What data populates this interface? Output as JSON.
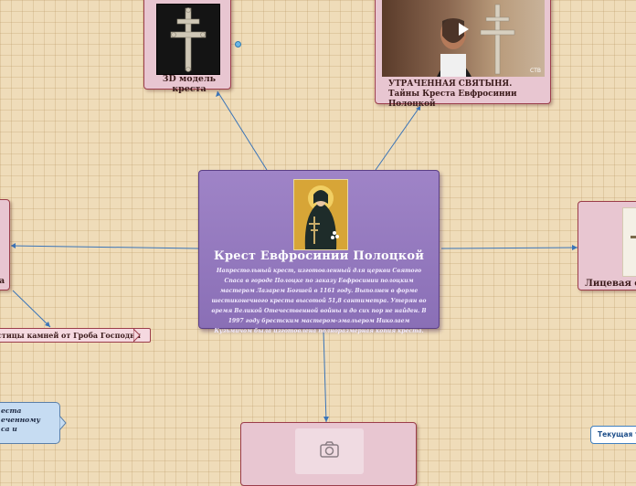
{
  "central": {
    "title": "Крест  Евфросинии Полоцкой",
    "description": "Напрестольный крест, изготовленный для церкви Святого Спаса в городе Полоцке по заказу Евфросинии полоцким мастером Лазарем Богшей в 1161 году. Выполнен в форме шестиконечного креста высотой 51,8 сантиметра. Утерян во время Великой Отечественной войны и до сих пор не найден. В 1997 году брестским мастером-эмальером Николаем Кузьмичом была изготовлена полноразмерная копия креста."
  },
  "nodes": {
    "model3d": {
      "label": "3D модель креста"
    },
    "video": {
      "label": "УТРАЧЕННАЯ СВЯТЫНЯ. Тайны Креста Евфросинии Полоцкой",
      "watermark": "СТВ"
    },
    "right_card": {
      "label": "Лицевая с"
    },
    "left_card": {
      "label": "а"
    },
    "tag": {
      "label": "стицы камней от Гроба Господня"
    },
    "blue_note": {
      "lines": [
        "еста",
        "еченному",
        "са и"
      ]
    },
    "small_button": {
      "label": "Текущая т"
    },
    "bottom_card": {
      "icon": "camera-icon"
    }
  },
  "colors": {
    "central_bg": "#9a7fc3",
    "card_bg": "#e8c6d1",
    "connector": "#3a74b8",
    "background": "#efdcb9"
  }
}
